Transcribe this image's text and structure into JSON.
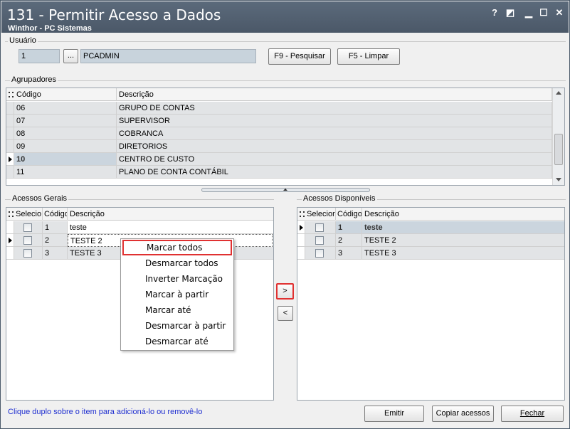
{
  "window": {
    "title": "131 - Permitir Acesso a Dados",
    "subtitle": "Winthor - PC Sistemas"
  },
  "titlebar_buttons": [
    "?",
    "◩",
    "▁",
    "☐",
    "✕"
  ],
  "usuario": {
    "label": "Usuário",
    "code": "1",
    "lookup_label": "...",
    "name": "PCADMIN",
    "search_button": "F9 - Pesquisar",
    "clear_button": "F5 - Limpar"
  },
  "agrupadores": {
    "label": "Agrupadores",
    "columns": [
      "Código",
      "Descrição"
    ],
    "rows": [
      {
        "code": "06",
        "desc": "GRUPO DE CONTAS"
      },
      {
        "code": "07",
        "desc": "SUPERVISOR"
      },
      {
        "code": "08",
        "desc": "COBRANCA"
      },
      {
        "code": "09",
        "desc": "DIRETORIOS"
      },
      {
        "code": "10",
        "desc": "CENTRO DE CUSTO"
      },
      {
        "code": "11",
        "desc": "PLANO DE CONTA CONTÁBIL"
      }
    ]
  },
  "acessos_gerais": {
    "label": "Acessos Gerais",
    "columns": [
      "Selecio",
      "Código",
      "Descrição"
    ],
    "rows": [
      {
        "code": "1",
        "desc": "teste"
      },
      {
        "code": "2",
        "desc": "TESTE 2"
      },
      {
        "code": "3",
        "desc": "TESTE 3"
      }
    ]
  },
  "acessos_disponiveis": {
    "label": "Acessos Disponíveis",
    "columns": [
      "Selecion",
      "Código",
      "Descrição"
    ],
    "rows": [
      {
        "code": "1",
        "desc": "teste"
      },
      {
        "code": "2",
        "desc": "TESTE 2"
      },
      {
        "code": "3",
        "desc": "TESTE 3"
      }
    ]
  },
  "move_buttons": {
    "add": ">",
    "remove": "<"
  },
  "context_menu": [
    "Marcar todos",
    "Desmarcar todos",
    "Inverter Marcação",
    "Marcar à partir",
    "Marcar até",
    "Desmarcar à partir",
    "Desmarcar até"
  ],
  "footer": {
    "hint": "Clique duplo sobre o item para adicioná-lo ou removê-lo",
    "emitir": "Emitir",
    "copiar": "Copiar acessos",
    "fechar": "Fechar"
  },
  "colors": {
    "titlebar": "#53606f",
    "highlight": "#e03131",
    "hint": "#1f2fd0"
  }
}
